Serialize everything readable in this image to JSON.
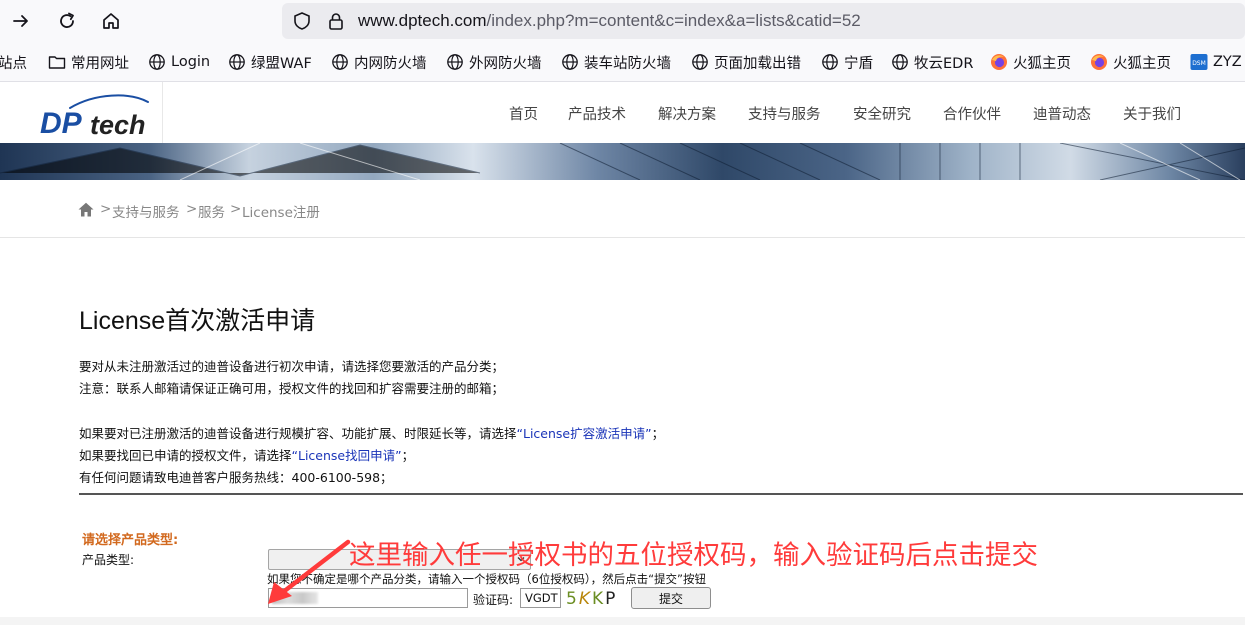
{
  "browser": {
    "url_host": "www.dptech.com",
    "url_path": "/index.php?m=content&c=index&a=lists&catid=52",
    "bookmarks": [
      {
        "label": "站点",
        "icon": "folder-icon"
      },
      {
        "label": "常用网址",
        "icon": "folder-icon"
      },
      {
        "label": "Login",
        "icon": "globe-icon"
      },
      {
        "label": "绿盟WAF",
        "icon": "globe-icon"
      },
      {
        "label": "内网防火墙",
        "icon": "globe-icon"
      },
      {
        "label": "外网防火墙",
        "icon": "globe-icon"
      },
      {
        "label": "装车站防火墙",
        "icon": "globe-icon"
      },
      {
        "label": "页面加载出错",
        "icon": "globe-icon"
      },
      {
        "label": "宁盾",
        "icon": "globe-icon"
      },
      {
        "label": "牧云EDR",
        "icon": "globe-icon"
      },
      {
        "label": "火狐主页",
        "icon": "firefox-icon"
      },
      {
        "label": "火狐主页",
        "icon": "firefox-icon"
      },
      {
        "label": "ZYZ",
        "icon": "dsm-icon"
      }
    ]
  },
  "site": {
    "logo_text_dp": "DP",
    "logo_text_tech": "tech",
    "menu": [
      "首页",
      "产品技术",
      "解决方案",
      "支持与服务",
      "安全研究",
      "合作伙伴",
      "迪普动态",
      "关于我们"
    ],
    "brand_color": "#1a4ea3"
  },
  "breadcrumb": {
    "items": [
      "支持与服务",
      "服务",
      "License注册"
    ],
    "separator": ">"
  },
  "content": {
    "title": "License首次激活申请",
    "p1": "要对从未注册激活过的迪普设备进行初次申请，请选择您要激活的产品分类；",
    "p2": "注意：联系人邮箱请保证正确可用，授权文件的找回和扩容需要注册的邮箱；",
    "p3_pre": "如果要对已注册激活的迪普设备进行规模扩容、功能扩展、时限延长等，请选择",
    "p3_link": "“License扩容激活申请”",
    "p3_post": "；",
    "p4_pre": "如果要找回已申请的授权文件，请选择",
    "p4_link": "“License找回申请”",
    "p4_post": "；",
    "p5": "有任何问题请致电迪普客户服务热线：400-6100-598；"
  },
  "form": {
    "section_label": "请选择产品类型:",
    "product_type_label": "产品类型:",
    "product_type_value": "",
    "hint": "如果您不确定是哪个产品分类，请输入一个授权码（6位授权码），然后点击“提交”按钮",
    "auth_code_value": "",
    "captcha_label": "验证码:",
    "captcha_value": "VGDT",
    "captcha_image_text": "5KKP",
    "submit_label": "提交"
  },
  "annotation": {
    "text": "这里输入任一授权书的五位授权码，输入验证码后点击提交",
    "color": "#ff3b3b"
  }
}
